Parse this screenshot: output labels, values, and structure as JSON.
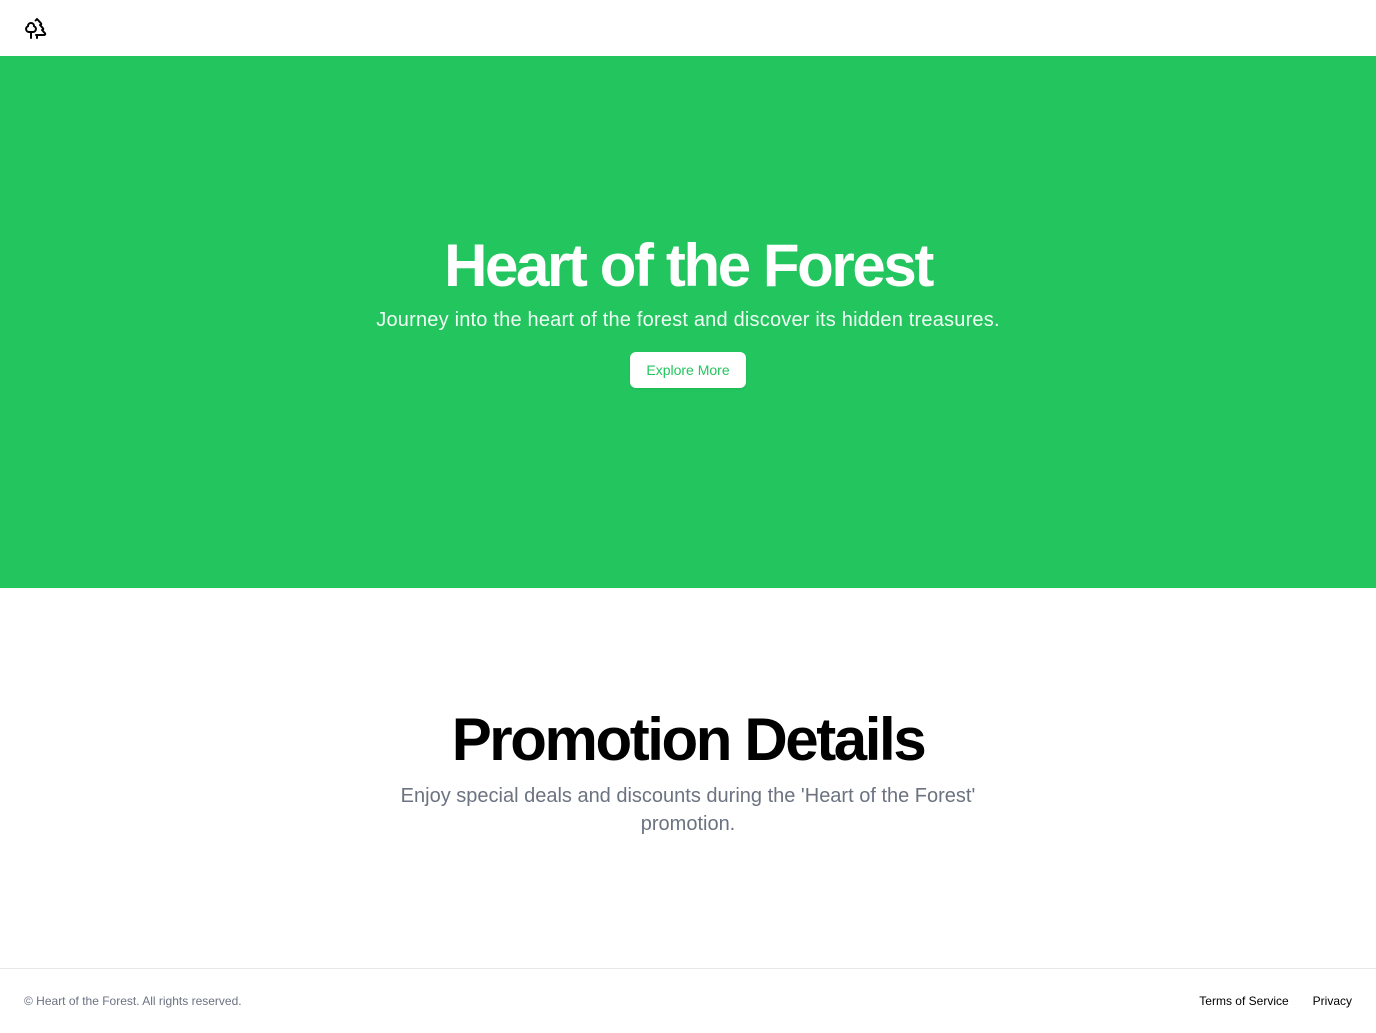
{
  "header": {
    "logo_icon": "trees-icon"
  },
  "hero": {
    "title": "Heart of the Forest",
    "subtitle": "Journey into the heart of the forest and discover its hidden treasures.",
    "button_label": "Explore More",
    "background_color": "#22c55e"
  },
  "promotion": {
    "title": "Promotion Details",
    "text": "Enjoy special deals and discounts during the 'Heart of the Forest' promotion."
  },
  "footer": {
    "copyright": "© Heart of the Forest. All rights reserved.",
    "links": [
      {
        "label": "Terms of Service"
      },
      {
        "label": "Privacy"
      }
    ]
  }
}
